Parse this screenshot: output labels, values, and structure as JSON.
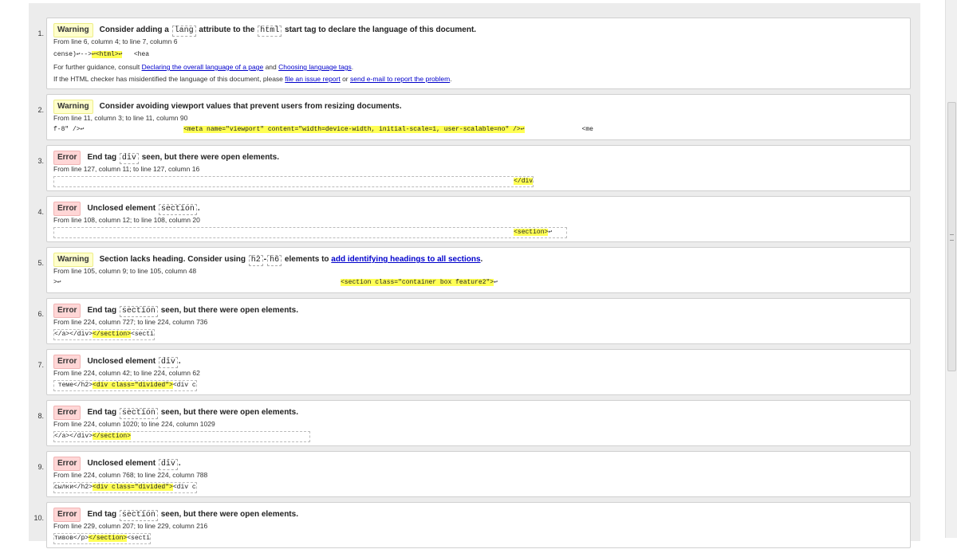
{
  "messages": [
    {
      "num": "1.",
      "type": "Warning",
      "loc": "From line 6, column 4; to line 7, column 6",
      "guidance_prefix": "For further guidance, consult ",
      "guidance_link1": "Declaring the overall language of a page",
      "guidance_and": " and ",
      "guidance_link2": "Choosing language tags",
      "guidance_suffix": ".",
      "misid_prefix": "If the HTML checker has misidentified the language of this document, please ",
      "misid_link1": "file an issue report",
      "misid_or": " or ",
      "misid_link2": "send e-mail to report the problem",
      "misid_suffix": ".",
      "msg_parts": [
        "Consider adding a ",
        "lang",
        " attribute to the ",
        "html",
        " start tag to declare the language of this document."
      ],
      "extract_pre": "cense)↩-->",
      "extract_hl": "↩<html>↩",
      "extract_post": "   <hea"
    },
    {
      "num": "2.",
      "type": "Warning",
      "loc": "From line 11, column 3; to line 11, column 90",
      "msg_parts": [
        "Consider avoiding viewport values that prevent users from resizing documents."
      ],
      "extract_pre": "f-8\" />↩                          ",
      "extract_hl": "<meta name=\"viewport\" content=\"width=device-width, initial-scale=1, user-scalable=no\" />↩",
      "extract_post": "               <me"
    },
    {
      "num": "3.",
      "type": "Error",
      "loc": "From line 127, column 11; to line 127, column 16",
      "msg_parts": [
        "End tag ",
        "div",
        " seen, but there were open elements."
      ],
      "extract_pre": "                                                                                                                        ",
      "extract_hl": "</div>",
      "extract_post": "↩                                 "
    },
    {
      "num": "4.",
      "type": "Error",
      "loc": "From line 108, column 12; to line 108, column 20",
      "msg_parts": [
        "Unclosed element ",
        "section",
        "."
      ],
      "extract_pre": "                                                                                                                        ",
      "extract_hl": "<section>",
      "extract_post": "↩                                    "
    },
    {
      "num": "5.",
      "type": "Warning",
      "loc": "From line 105, column 9; to line 105, column 48",
      "msg_parts": [
        "Section lacks heading. Consider using ",
        "h2",
        "-",
        "h6",
        " elements to ",
        "add identifying headings to all sections",
        "."
      ],
      "extract_pre": ">↩                                                                         ",
      "extract_hl": "<section class=\"container box feature2\">",
      "extract_post": "↩"
    },
    {
      "num": "6.",
      "type": "Error",
      "loc": "From line 224, column 727; to line 224, column 736",
      "msg_parts": [
        "End tag ",
        "section",
        " seen, but there were open elements."
      ],
      "extract_pre": "</a></div>",
      "extract_hl": "</section>",
      "extract_post": "<secti"
    },
    {
      "num": "7.",
      "type": "Error",
      "loc": "From line 224, column 42; to line 224, column 62",
      "msg_parts": [
        "Unclosed element ",
        "div",
        "."
      ],
      "extract_pre": " теме</h2>",
      "extract_hl": "<div class=\"divided\">",
      "extract_post": "<div c"
    },
    {
      "num": "8.",
      "type": "Error",
      "loc": "From line 224, column 1020; to line 224, column 1029",
      "msg_parts": [
        "End tag ",
        "section",
        " seen, but there were open elements."
      ],
      "extract_pre": "</a></div>",
      "extract_hl": "</section>",
      "extract_post": "                                     "
    },
    {
      "num": "9.",
      "type": "Error",
      "loc": "From line 224, column 768; to line 224, column 788",
      "msg_parts": [
        "Unclosed element ",
        "div",
        "."
      ],
      "extract_pre": "сылки</h2>",
      "extract_hl": "<div class=\"divided\">",
      "extract_post": "<div c"
    },
    {
      "num": "10.",
      "type": "Error",
      "loc": "From line 229, column 207; to line 229, column 216",
      "msg_parts": [
        "End tag ",
        "section",
        " seen, but there were open elements."
      ],
      "extract_pre": "тивов</p>",
      "extract_hl": "</section>",
      "extract_post": "<secti"
    }
  ]
}
